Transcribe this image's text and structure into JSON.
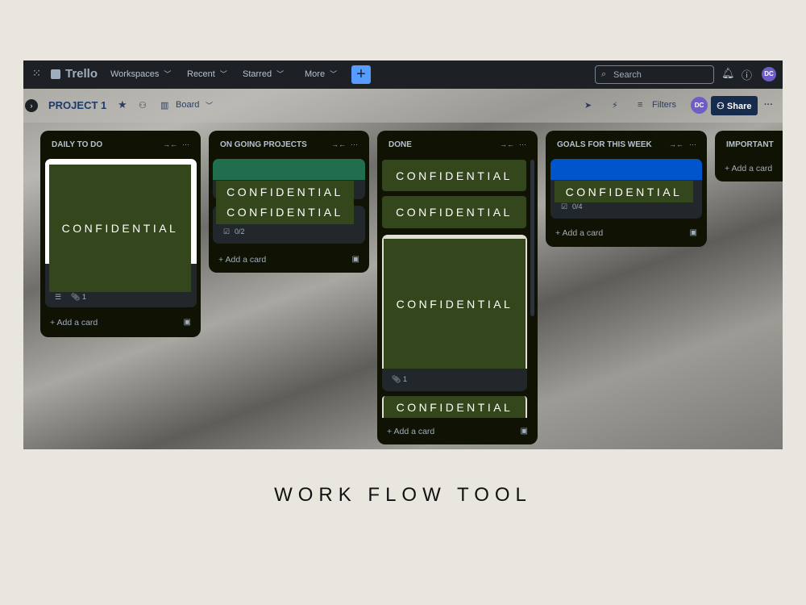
{
  "nav": {
    "apps_icon": "grid-icon",
    "logo": "Trello",
    "menus": [
      "Workspaces",
      "Recent",
      "Starred",
      "More"
    ],
    "create_icon": "plus-icon",
    "search_placeholder": "Search",
    "notifications_icon": "bell-icon",
    "help_icon": "help-icon",
    "avatar": "DC"
  },
  "board": {
    "title": "PROJECT 1",
    "view": "Board",
    "filters": "Filters",
    "share": "Share",
    "avatar": "DC"
  },
  "lists": [
    {
      "title": "DAILY TO DO",
      "add": "Add a card",
      "cards": [
        {
          "text": "CONFIDENTIAL",
          "attachments": "1"
        }
      ]
    },
    {
      "title": "ON GOING PROJECTS",
      "add": "Add a card",
      "cover_color": "#216e4e",
      "cards": [
        {
          "text": "CONFIDENTIAL"
        },
        {
          "text": "CONFIDENTIAL",
          "checklist": "0/2"
        }
      ]
    },
    {
      "title": "DONE",
      "add": "Add a card",
      "cards": [
        {
          "text": "CONFIDENTIAL"
        },
        {
          "text": "CONFIDENTIAL"
        },
        {
          "text": "CONFIDENTIAL",
          "attachments": "1"
        },
        {
          "text": "CONFIDENTIAL"
        }
      ]
    },
    {
      "title": "GOALS FOR THIS WEEK",
      "add": "Add a card",
      "cover_color": "#0055cc",
      "cards": [
        {
          "text": "CONFIDENTIAL",
          "checklist": "0/4"
        }
      ]
    },
    {
      "title": "IMPORTANT",
      "add": "Add a card"
    }
  ],
  "caption": "WORK FLOW TOOL"
}
